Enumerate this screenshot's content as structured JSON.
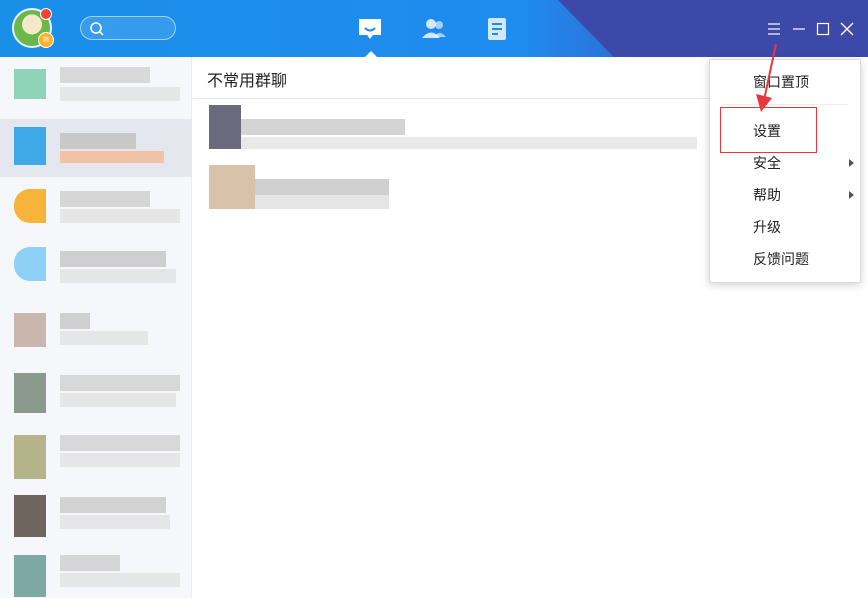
{
  "titlebar": {
    "colors": {
      "left": "#1a8fe8",
      "right": "#3c49a8",
      "highlight_border": "#e8383d",
      "arrow": "#e8383d"
    },
    "nav_icons": [
      "messages-icon",
      "contacts-icon",
      "documents-icon"
    ],
    "window_controls": [
      "menu-icon",
      "minimize-icon",
      "maximize-icon",
      "close-icon"
    ]
  },
  "content": {
    "title": "不常用群聊"
  },
  "menu": {
    "items": [
      {
        "label": "窗口置顶",
        "has_submenu": false
      },
      {
        "label": "设置",
        "has_submenu": false
      },
      {
        "label": "安全",
        "has_submenu": true
      },
      {
        "label": "帮助",
        "has_submenu": true
      },
      {
        "label": "升级",
        "has_submenu": false
      },
      {
        "label": "反馈问题",
        "has_submenu": false
      }
    ]
  }
}
